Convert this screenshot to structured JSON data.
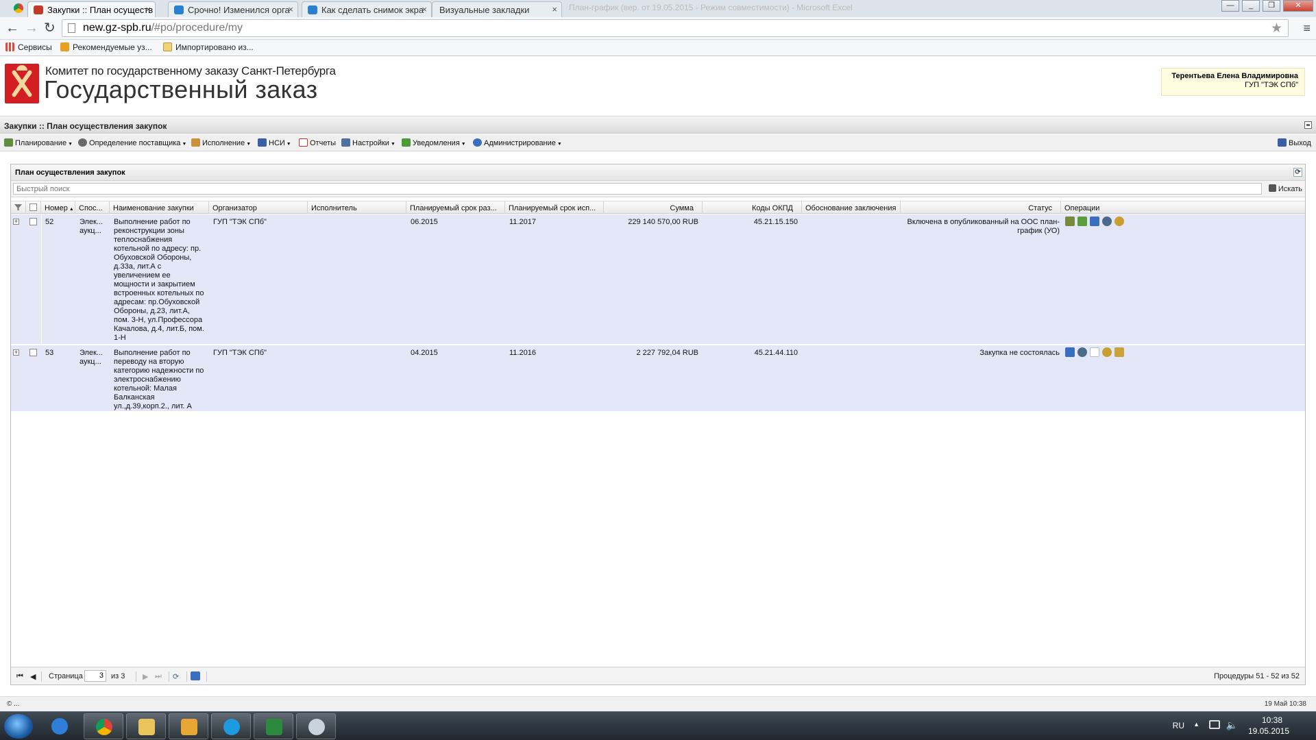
{
  "browser": {
    "tabs": [
      {
        "title": "Закупки :: План осуществ",
        "active": true,
        "icon_color": "#c0392b"
      },
      {
        "title": "Срочно! Изменился орга",
        "active": false,
        "icon_color": "#2a7fd1"
      },
      {
        "title": "Как сделать снимок экра",
        "active": false,
        "icon_color": "#2a7fd1"
      },
      {
        "title": "Визуальные закладки",
        "active": false,
        "icon_color": "#999999"
      }
    ],
    "faded_tab_text": "План-график (вер. от 19.05.2015 - Режим совместимости) - Microsoft Excel",
    "url_host": "new.gz-spb.ru",
    "url_path": "/#po/procedure/my",
    "bookmarks": [
      "Сервисы",
      "Рекомендуемые уз...",
      "Импортировано из..."
    ]
  },
  "site": {
    "subtitle": "Комитет по государственному заказу Санкт-Петербурга",
    "title": "Государственный заказ",
    "user_name": "Терентьева Елена Владимировна",
    "user_org": "ГУП \"ТЭК СПб\""
  },
  "app": {
    "breadcrumb": "Закупки :: План осуществления закупок",
    "menu": [
      {
        "label": "Планирование",
        "icon": "grid-icon",
        "dropdown": true
      },
      {
        "label": "Определение поставщика",
        "icon": "users-icon",
        "dropdown": true
      },
      {
        "label": "Исполнение",
        "icon": "handshake-icon",
        "dropdown": true
      },
      {
        "label": "НСИ",
        "icon": "book-icon",
        "dropdown": true
      },
      {
        "label": "Отчеты",
        "icon": "report-icon",
        "dropdown": false
      },
      {
        "label": "Настройки",
        "icon": "wrench-icon",
        "dropdown": true
      },
      {
        "label": "Уведомления",
        "icon": "envelope-icon",
        "dropdown": true
      },
      {
        "label": "Администрирование",
        "icon": "user-icon",
        "dropdown": true
      }
    ],
    "logout": "Выход"
  },
  "panel": {
    "title": "План осуществления закупок",
    "search_placeholder": "Быстрый поиск",
    "search_button": "Искать",
    "columns": {
      "number": "Номер",
      "method": "Спос...",
      "name": "Наименование закупки",
      "organizer": "Организатор",
      "executor": "Исполнитель",
      "plan_place": "Планируемый срок раз...",
      "plan_exec": "Планируемый срок исп...",
      "sum": "Сумма",
      "okpd": "Коды ОКПД",
      "reason": "Обоснование заключения",
      "status": "Статус",
      "operations": "Операции"
    },
    "rows": [
      {
        "number": "52",
        "method": "Элек... аукц...",
        "name": "Выполнение работ по реконструкции зоны теплоснабжения котельной по адресу: пр. Обуховской Обороны, д.33а, лит.А с увеличением ее мощности и закрытием встроенных котельных по адресам: пр.Обуховской Обороны, д.23, лит.А, пом. 3-Н, ул.Профессора Качалова, д.4, лит.Б, пом. 1-Н",
        "organizer": "ГУП \"ТЭК СПб\"",
        "executor": "",
        "plan_place": "06.2015",
        "plan_exec": "11.2017",
        "sum": "229 140 570,00 RUB",
        "okpd": "45.21.15.150",
        "reason": "",
        "status": "Включена в опубликованный на ООС план-график (УО)",
        "ops": [
          {
            "icon": "edit-icon",
            "color": "#7a8a3c"
          },
          {
            "icon": "approve-icon",
            "color": "#5a9e3c"
          },
          {
            "icon": "chart-icon",
            "color": "#3a6fbf"
          },
          {
            "icon": "gear-icon",
            "color": "#4c6a8a"
          },
          {
            "icon": "emblem-icon",
            "color": "#c8a030"
          }
        ]
      },
      {
        "number": "53",
        "method": "Элек... аукц...",
        "name": "Выполнение работ по переводу на вторую категорию надежности по электроснабжению котельной: Малая Балканская ул.,д.39,корп.2., лит. А",
        "organizer": "ГУП \"ТЭК СПб\"",
        "executor": "",
        "plan_place": "04.2015",
        "plan_exec": "11.2016",
        "sum": "2 227 792,04 RUB",
        "okpd": "45.21.44.110",
        "reason": "",
        "status": "Закупка не состоялась",
        "ops": [
          {
            "icon": "chart-icon",
            "color": "#3a6fbf"
          },
          {
            "icon": "gear-icon",
            "color": "#4c6a8a"
          },
          {
            "icon": "document-icon",
            "color": "#b9bcc2"
          },
          {
            "icon": "emblem-icon",
            "color": "#c8a030"
          },
          {
            "icon": "scroll-icon",
            "color": "#c9a43a"
          }
        ]
      }
    ],
    "pager": {
      "page_label": "Страница",
      "page_value": "3",
      "of_label": "из 3",
      "summary": "Процедуры 51 - 52 из 52"
    }
  },
  "statusbar": {
    "left": "© ...",
    "right": "19 Май 10:38"
  },
  "taskbar": {
    "apps": [
      {
        "name": "ie-icon",
        "color": "#2f7fd8"
      },
      {
        "name": "chrome-icon",
        "color": "#d9493a"
      },
      {
        "name": "folder-icon",
        "color": "#e8c45a"
      },
      {
        "name": "outlook-icon",
        "color": "#e8a735"
      },
      {
        "name": "skype-icon",
        "color": "#1e9be0"
      },
      {
        "name": "excel-icon",
        "color": "#2c8a3e"
      },
      {
        "name": "paint-icon",
        "color": "#c9d3dc"
      }
    ],
    "lang": "RU",
    "time": "10:38",
    "date": "19.05.2015"
  }
}
